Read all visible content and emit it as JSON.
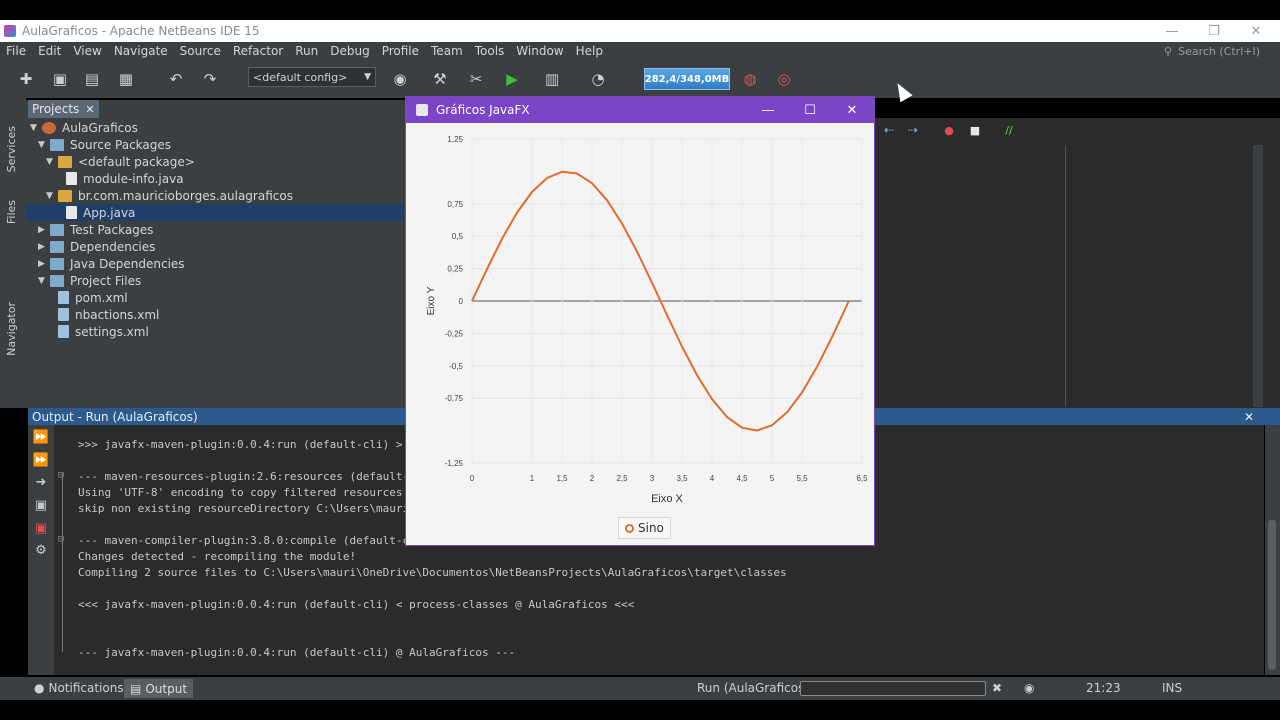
{
  "window": {
    "title": "AulaGraficos - Apache NetBeans IDE 15",
    "controls": {
      "minimize": "—",
      "restore": "❐",
      "close": "✕"
    }
  },
  "menu": [
    "File",
    "Edit",
    "View",
    "Navigate",
    "Source",
    "Refactor",
    "Run",
    "Debug",
    "Profile",
    "Team",
    "Tools",
    "Window",
    "Help"
  ],
  "search": {
    "placeholder": "Search (Ctrl+I)"
  },
  "toolbar": {
    "config": "<default config>",
    "memory": "282,4/348,0MB"
  },
  "side_tabs": [
    "Services",
    "Files",
    "Navigator"
  ],
  "projects": {
    "tab_label": "Projects",
    "tab_close": "✕",
    "tree": [
      {
        "label": "AulaGraficos",
        "level": 0,
        "expanded": true,
        "icon": "project-icon"
      },
      {
        "label": "Source Packages",
        "level": 1,
        "expanded": true,
        "icon": "folder-icon"
      },
      {
        "label": "<default package>",
        "level": 2,
        "expanded": true,
        "icon": "package-icon"
      },
      {
        "label": "module-info.java",
        "level": 3,
        "icon": "java-file-icon"
      },
      {
        "label": "br.com.mauricioborges.aulagraficos",
        "level": 2,
        "expanded": true,
        "icon": "package-icon"
      },
      {
        "label": "App.java",
        "level": 3,
        "icon": "java-file-icon",
        "selected": true
      },
      {
        "label": "Test Packages",
        "level": 1,
        "expanded": false,
        "icon": "folder-icon"
      },
      {
        "label": "Dependencies",
        "level": 1,
        "expanded": false,
        "icon": "folder-icon"
      },
      {
        "label": "Java Dependencies",
        "level": 1,
        "expanded": false,
        "icon": "folder-icon"
      },
      {
        "label": "Project Files",
        "level": 1,
        "expanded": true,
        "icon": "folder-icon"
      },
      {
        "label": "pom.xml",
        "level": 2,
        "icon": "maven-file-icon"
      },
      {
        "label": "nbactions.xml",
        "level": 2,
        "icon": "xml-file-icon"
      },
      {
        "label": "settings.xml",
        "level": 2,
        "icon": "xml-file-icon"
      }
    ]
  },
  "output": {
    "header": "Output - Run (AulaGraficos)",
    "close": "✕",
    "lines": [
      ">>> javafx-maven-plugin:0.0.4:run (default-cli) >",
      "--- maven-resources-plugin:2.6:resources (default-",
      "Using 'UTF-8' encoding to copy filtered resources.",
      "skip non existing resourceDirectory C:\\Users\\mauri",
      "--- maven-compiler-plugin:3.8.0:compile (default-c",
      "Changes detected - recompiling the module!",
      "Compiling 2 source files to C:\\Users\\mauri\\OneDrive\\Documentos\\NetBeansProjects\\AulaGraficos\\target\\classes",
      "<<< javafx-maven-plugin:0.0.4:run (default-cli) < process-classes @ AulaGraficos <<<",
      "--- javafx-maven-plugin:0.0.4:run (default-cli) @ AulaGraficos ---"
    ]
  },
  "statusbar": {
    "notifications": "Notifications",
    "output_tab": "Output",
    "run_label": "Run (AulaGraficos)",
    "position": "21:23",
    "mode": "INS"
  },
  "fx_window": {
    "title": "Gráficos JavaFX",
    "controls": {
      "minimize": "—",
      "maximize": "☐",
      "close": "✕"
    }
  },
  "chart_data": {
    "type": "line",
    "xlabel": "Eixo X",
    "ylabel": "Eixo Y",
    "xlim": [
      0,
      6.5
    ],
    "ylim": [
      -1.25,
      1.25
    ],
    "x_ticks": [
      "0",
      "1",
      "1,5",
      "2",
      "2,5",
      "3",
      "3,5",
      "4",
      "4,5",
      "5",
      "5,5",
      "6,5"
    ],
    "x_tick_values": [
      0,
      1,
      1.5,
      2,
      2.5,
      3,
      3.5,
      4,
      4.5,
      5,
      5.5,
      6.5
    ],
    "y_ticks": [
      "1,25",
      "0,75",
      "0,5",
      "0,25",
      "0",
      "-0,25",
      "-0,5",
      "-0,75",
      "-1,25"
    ],
    "y_tick_values": [
      1.25,
      0.75,
      0.5,
      0.25,
      0,
      -0.25,
      -0.5,
      -0.75,
      -1.25
    ],
    "grid": true,
    "legend": "bottom",
    "series": [
      {
        "name": "Sino",
        "color": "#e06c2e",
        "x": [
          0,
          0.25,
          0.5,
          0.75,
          1,
          1.25,
          1.5,
          1.75,
          2,
          2.25,
          2.5,
          2.75,
          3,
          3.25,
          3.5,
          3.75,
          4,
          4.25,
          4.5,
          4.75,
          5,
          5.25,
          5.5,
          5.75,
          6,
          6.28
        ],
        "y": [
          0,
          0.247,
          0.479,
          0.682,
          0.841,
          0.949,
          0.997,
          0.984,
          0.909,
          0.778,
          0.598,
          0.382,
          0.141,
          -0.108,
          -0.351,
          -0.572,
          -0.757,
          -0.895,
          -0.978,
          -0.999,
          -0.959,
          -0.859,
          -0.706,
          -0.508,
          -0.279,
          0
        ]
      }
    ]
  }
}
